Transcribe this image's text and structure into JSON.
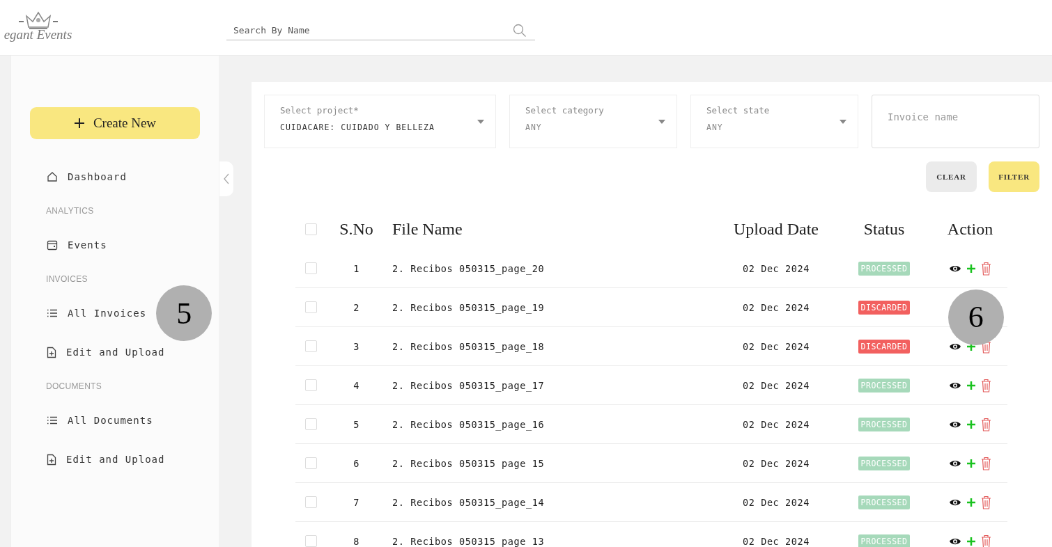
{
  "logo": {
    "text": "egant Events"
  },
  "search": {
    "placeholder": "Search By Name"
  },
  "sidebar": {
    "create_button": "Create New",
    "items": [
      {
        "kind": "home",
        "label": "Dashboard"
      },
      {
        "kind": "section",
        "label": "ANALYTICS"
      },
      {
        "kind": "calendar",
        "label": "Events"
      },
      {
        "kind": "section",
        "label": "INVOICES"
      },
      {
        "kind": "list",
        "label": "All Invoices",
        "callout": "5"
      },
      {
        "kind": "upload",
        "label": "Edit and Upload"
      },
      {
        "kind": "section",
        "label": "DOCUMENTS"
      },
      {
        "kind": "list",
        "label": "All Documents"
      },
      {
        "kind": "upload",
        "label": "Edit and Upload"
      }
    ]
  },
  "filters": [
    {
      "label": "Select project*",
      "value": "CUIDACARE: CUIDADO Y BELLEZA"
    },
    {
      "label": "Select category",
      "placeholder": "ANY"
    },
    {
      "label": "Select state",
      "placeholder": "ANY"
    }
  ],
  "invoice_name": {
    "placeholder": "Invoice name"
  },
  "buttons": [
    {
      "kind": "clear",
      "label": "CLEAR"
    },
    {
      "kind": "filter",
      "label": "FILTER"
    }
  ],
  "table": {
    "select_all_checked": false,
    "columns": [
      "S.No",
      "File Name",
      "Upload Date",
      "Status",
      "Action"
    ],
    "rows": [
      {
        "sno": "1",
        "file": "2. Recibos 050315_page_20",
        "date": "02 Dec 2024",
        "status": "PROCESSED",
        "color": "#a6d9ba",
        "checked": false
      },
      {
        "sno": "2",
        "file": "2. Recibos 050315_page_19",
        "date": "02 Dec 2024",
        "status": "DISCARDED",
        "color": "#f2605f",
        "checked": false,
        "callout": "6"
      },
      {
        "sno": "3",
        "file": "2. Recibos 050315_page_18",
        "date": "02 Dec 2024",
        "status": "DISCARDED",
        "color": "#f2605f",
        "checked": false
      },
      {
        "sno": "4",
        "file": "2. Recibos 050315_page_17",
        "date": "02 Dec 2024",
        "status": "PROCESSED",
        "color": "#a6d9ba",
        "checked": false
      },
      {
        "sno": "5",
        "file": "2. Recibos 050315_page_16",
        "date": "02 Dec 2024",
        "status": "PROCESSED",
        "color": "#a6d9ba",
        "checked": false
      },
      {
        "sno": "6",
        "file": "2. Recibos 050315 page 15",
        "date": "02 Dec 2024",
        "status": "PROCESSED",
        "color": "#a6d9ba",
        "checked": false
      },
      {
        "sno": "7",
        "file": "2. Recibos 050315_page_14",
        "date": "02 Dec 2024",
        "status": "PROCESSED",
        "color": "#a6d9ba",
        "checked": false
      },
      {
        "sno": "8",
        "file": "2. Recibos 050315 page 13",
        "date": "02 Dec 2024",
        "status": "PROCESSED",
        "color": "#a6d9ba",
        "checked": false
      }
    ]
  }
}
